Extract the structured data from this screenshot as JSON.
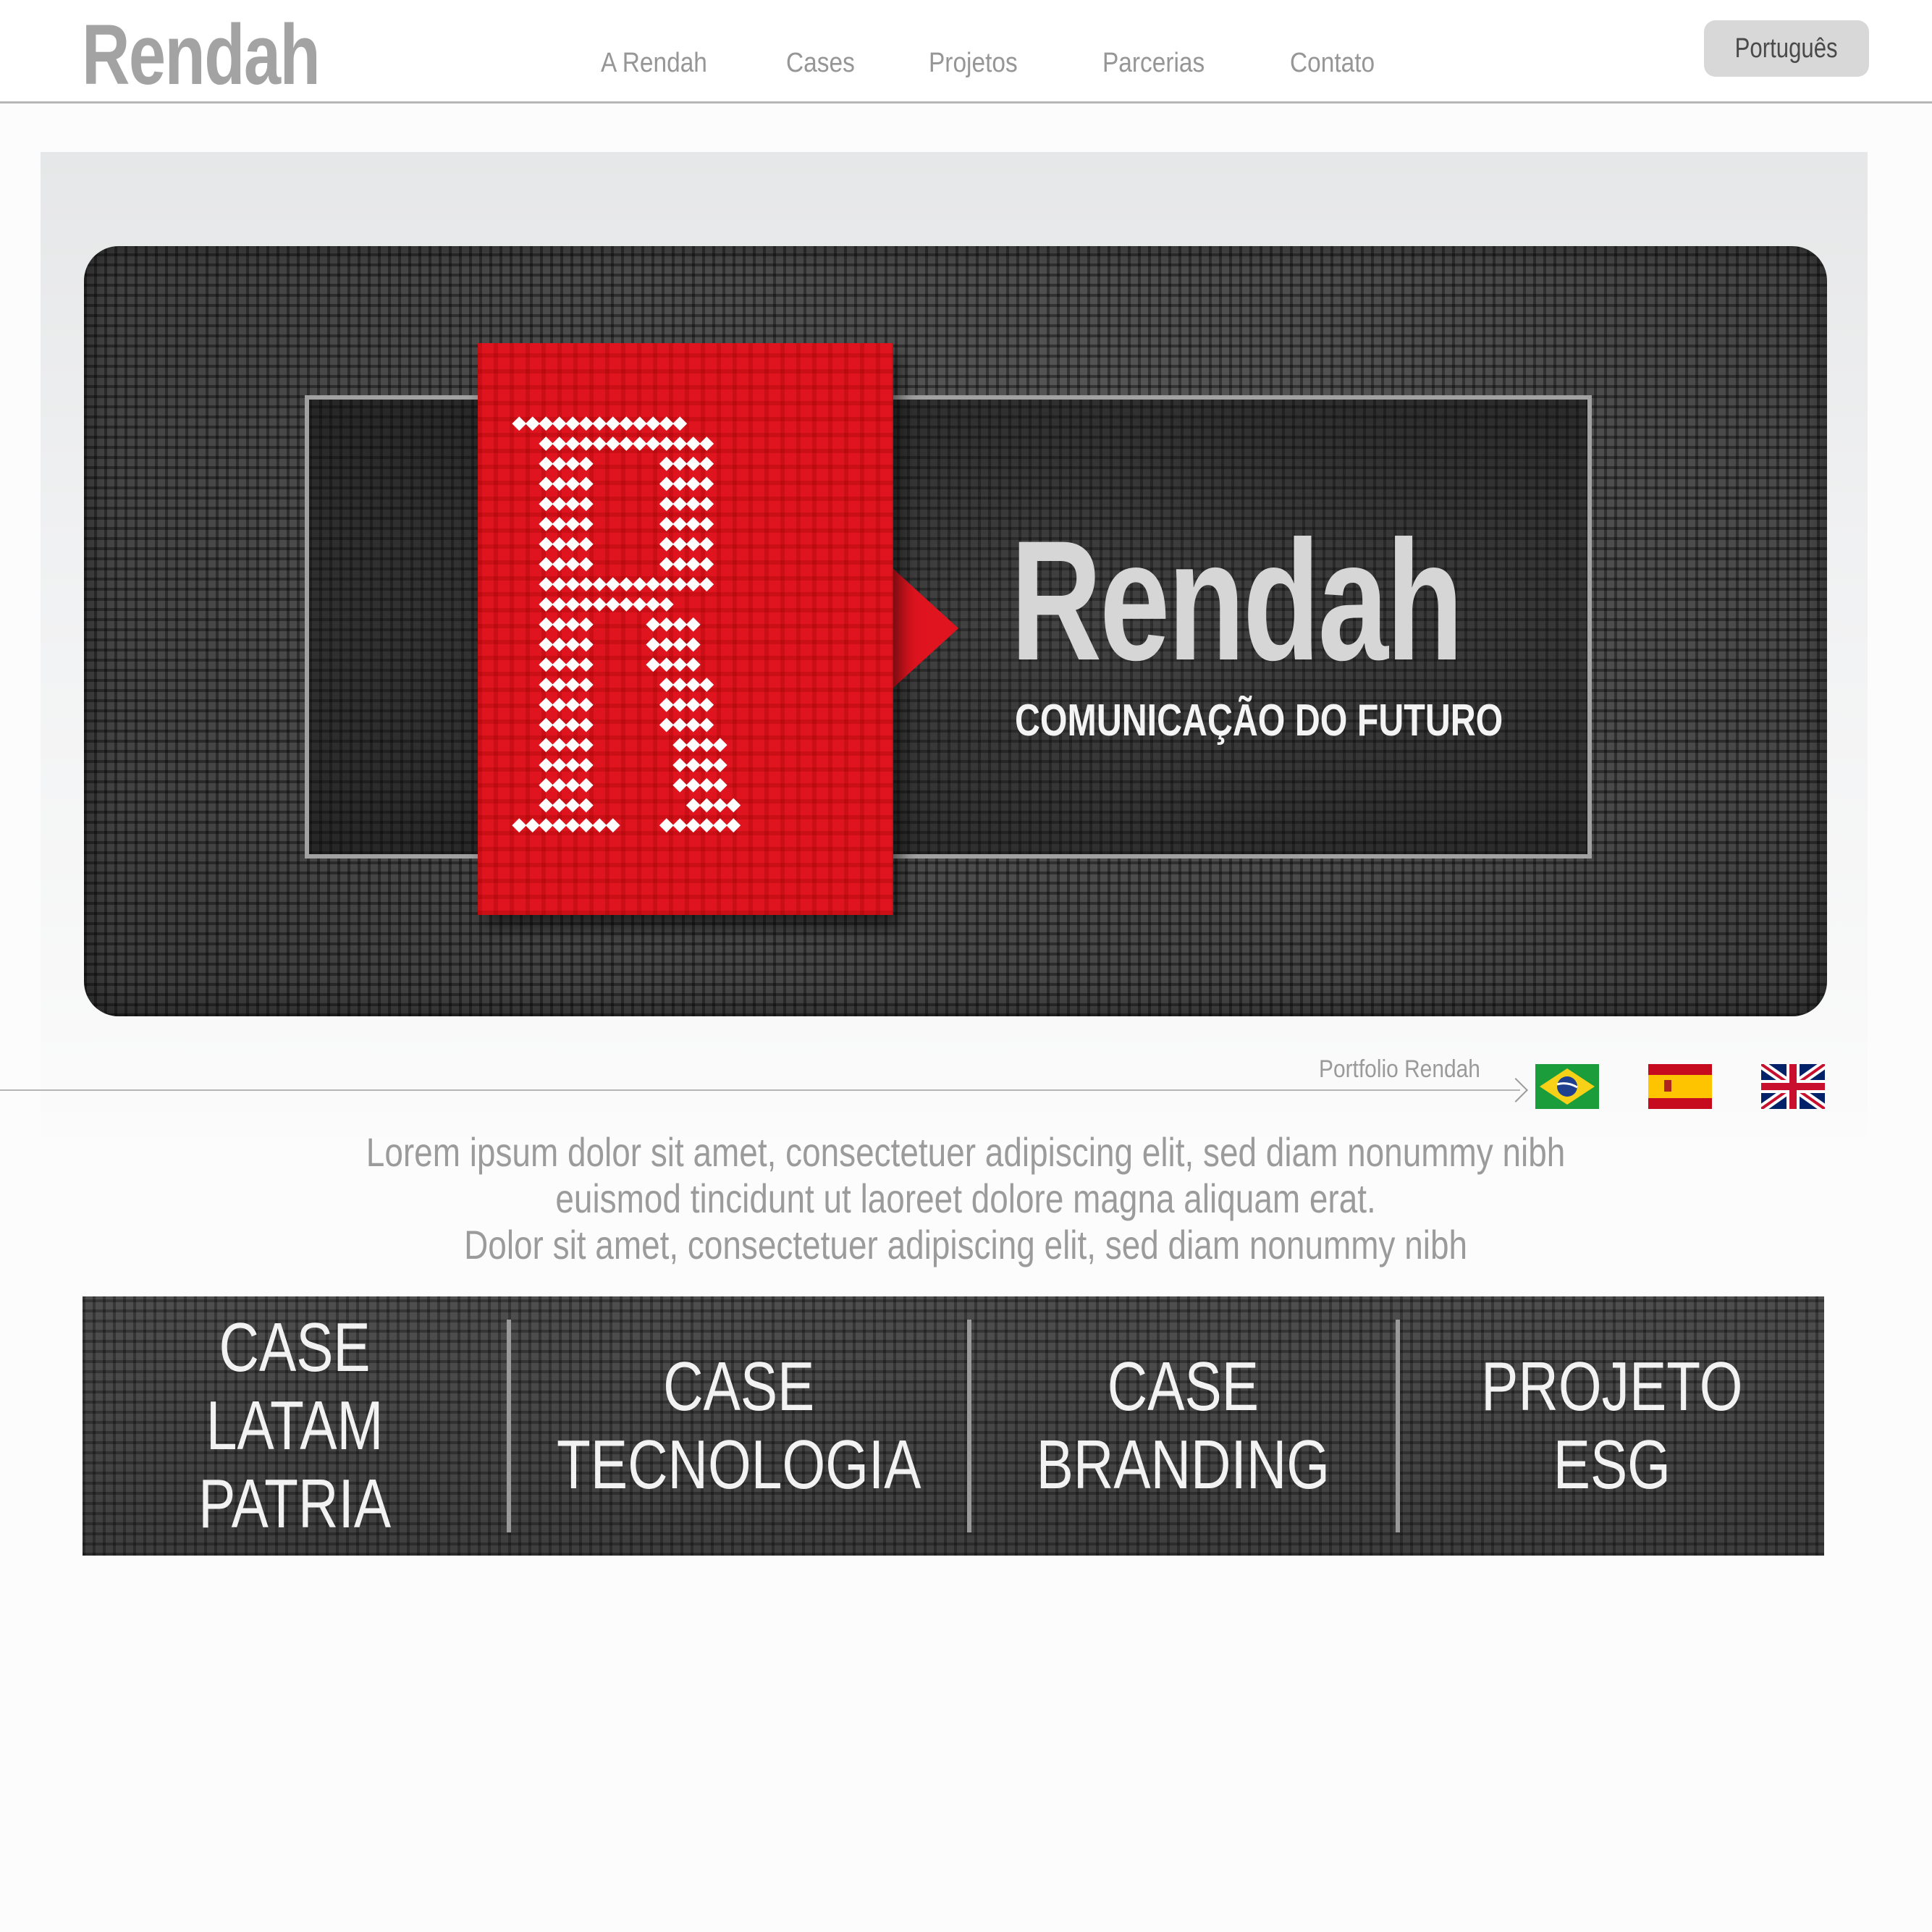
{
  "header": {
    "logo": "Rendah",
    "nav": [
      "A Rendah",
      "Cases",
      "Projetos",
      "Parcerias",
      "Contato"
    ],
    "language_button": "Português"
  },
  "hero": {
    "title": "Rendah",
    "tagline": "COMUNICAÇÃO DO FUTURO",
    "monogram": "R",
    "colors": {
      "brand_red": "#e0141f",
      "dark_panel": "#444444"
    }
  },
  "portfolio": {
    "label": "Portfolio Rendah",
    "flags": [
      "brazil-flag-icon",
      "spain-flag-icon",
      "uk-flag-icon"
    ]
  },
  "intro": {
    "lines": [
      "Lorem ipsum dolor sit amet, consectetuer adipiscing elit, sed diam nonummy nibh",
      "euismod tincidunt ut laoreet dolore magna aliquam erat.",
      "Dolor sit amet, consectetuer adipiscing elit, sed diam nonummy nibh"
    ]
  },
  "cases": [
    {
      "label": "CASE LATAM\nPATRIA"
    },
    {
      "label": "CASE\nTECNOLOGIA"
    },
    {
      "label": "CASE\nBRANDING"
    },
    {
      "label": "PROJETO\nESG"
    }
  ]
}
